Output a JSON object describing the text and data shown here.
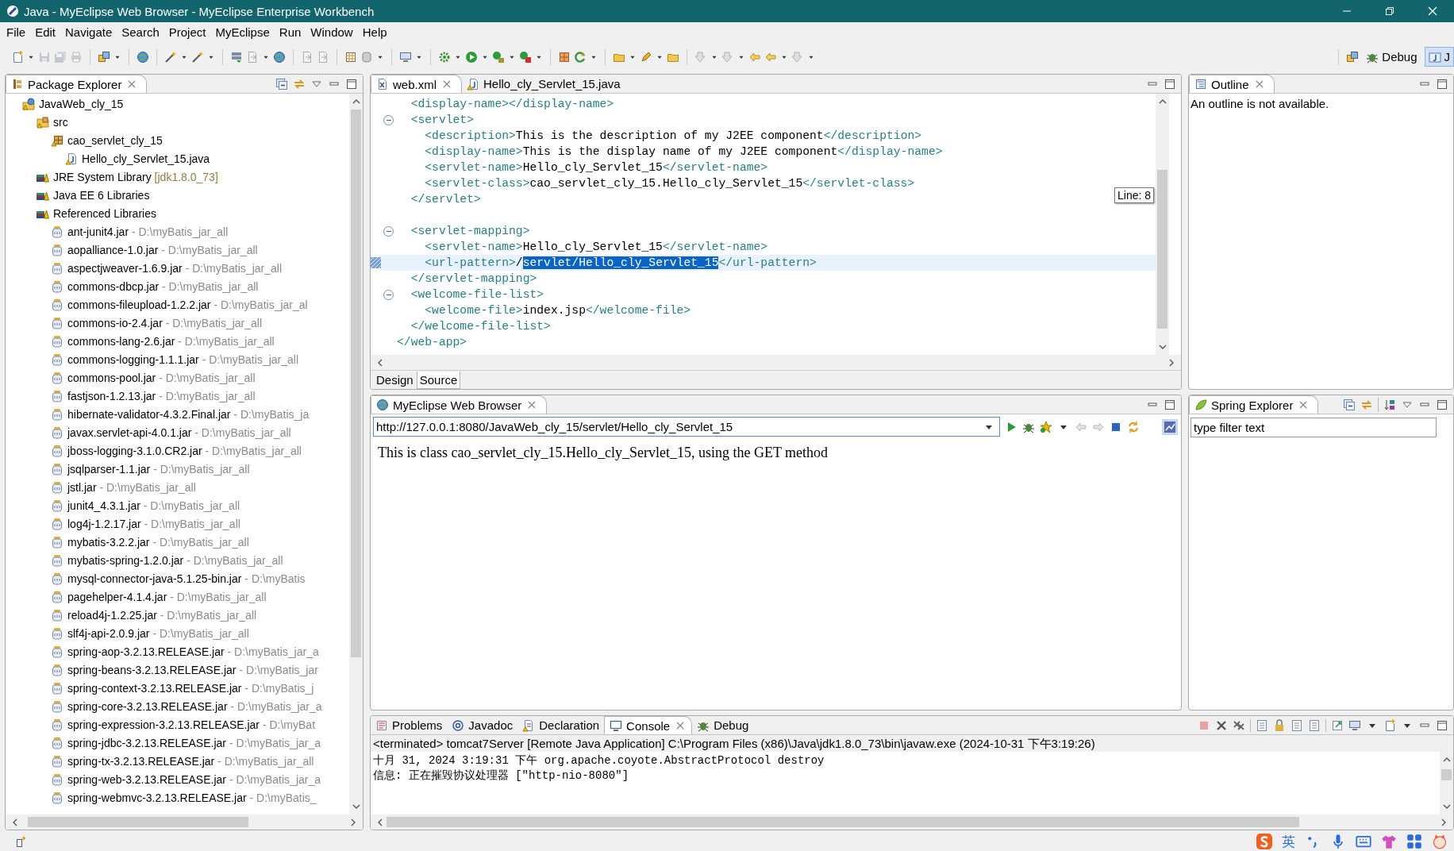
{
  "window": {
    "title": "Java - MyEclipse Web Browser - MyEclipse Enterprise Workbench"
  },
  "menu": [
    "File",
    "Edit",
    "Navigate",
    "Search",
    "Project",
    "MyEclipse",
    "Run",
    "Window",
    "Help"
  ],
  "perspectives": [
    {
      "label": "Debug",
      "kind": "debug",
      "selected": false
    },
    {
      "label": "J",
      "kind": "java",
      "selected": true
    }
  ],
  "package_explorer": {
    "title": "Package Explorer",
    "tree": [
      {
        "label": "JavaWeb_cly_15",
        "kind": "project",
        "children": [
          {
            "label": "src",
            "kind": "source-folder",
            "children": [
              {
                "label": "cao_servlet_cly_15",
                "kind": "package",
                "children": [
                  {
                    "label": "Hello_cly_Servlet_15.java",
                    "kind": "java-file"
                  }
                ]
              }
            ]
          },
          {
            "label": "JRE System Library",
            "detail": "[jdk1.8.0_73]",
            "kind": "library"
          },
          {
            "label": "Java EE 6 Libraries",
            "kind": "library"
          },
          {
            "label": "Referenced Libraries",
            "kind": "library",
            "children": [
              {
                "label": "ant-junit4.jar",
                "detail": "- D:\\myBatis_jar_all",
                "kind": "jar"
              },
              {
                "label": "aopalliance-1.0.jar",
                "detail": "- D:\\myBatis_jar_all",
                "kind": "jar"
              },
              {
                "label": "aspectjweaver-1.6.9.jar",
                "detail": "- D:\\myBatis_jar_all",
                "kind": "jar"
              },
              {
                "label": "commons-dbcp.jar",
                "detail": "- D:\\myBatis_jar_all",
                "kind": "jar"
              },
              {
                "label": "commons-fileupload-1.2.2.jar",
                "detail": "- D:\\myBatis_jar_al",
                "kind": "jar"
              },
              {
                "label": "commons-io-2.4.jar",
                "detail": "- D:\\myBatis_jar_all",
                "kind": "jar"
              },
              {
                "label": "commons-lang-2.6.jar",
                "detail": "- D:\\myBatis_jar_all",
                "kind": "jar"
              },
              {
                "label": "commons-logging-1.1.1.jar",
                "detail": "- D:\\myBatis_jar_all",
                "kind": "jar"
              },
              {
                "label": "commons-pool.jar",
                "detail": "- D:\\myBatis_jar_all",
                "kind": "jar"
              },
              {
                "label": "fastjson-1.2.13.jar",
                "detail": "- D:\\myBatis_jar_all",
                "kind": "jar"
              },
              {
                "label": "hibernate-validator-4.3.2.Final.jar",
                "detail": "- D:\\myBatis_ja",
                "kind": "jar"
              },
              {
                "label": "javax.servlet-api-4.0.1.jar",
                "detail": "- D:\\myBatis_jar_all",
                "kind": "jar"
              },
              {
                "label": "jboss-logging-3.1.0.CR2.jar",
                "detail": "- D:\\myBatis_jar_all",
                "kind": "jar"
              },
              {
                "label": "jsqlparser-1.1.jar",
                "detail": "- D:\\myBatis_jar_all",
                "kind": "jar"
              },
              {
                "label": "jstl.jar",
                "detail": "- D:\\myBatis_jar_all",
                "kind": "jar"
              },
              {
                "label": "junit4_4.3.1.jar",
                "detail": "- D:\\myBatis_jar_all",
                "kind": "jar"
              },
              {
                "label": "log4j-1.2.17.jar",
                "detail": "- D:\\myBatis_jar_all",
                "kind": "jar"
              },
              {
                "label": "mybatis-3.2.2.jar",
                "detail": "- D:\\myBatis_jar_all",
                "kind": "jar"
              },
              {
                "label": "mybatis-spring-1.2.0.jar",
                "detail": "- D:\\myBatis_jar_all",
                "kind": "jar"
              },
              {
                "label": "mysql-connector-java-5.1.25-bin.jar",
                "detail": "- D:\\myBatis",
                "kind": "jar"
              },
              {
                "label": "pagehelper-4.1.4.jar",
                "detail": "- D:\\myBatis_jar_all",
                "kind": "jar"
              },
              {
                "label": "reload4j-1.2.25.jar",
                "detail": "- D:\\myBatis_jar_all",
                "kind": "jar"
              },
              {
                "label": "slf4j-api-2.0.9.jar",
                "detail": "- D:\\myBatis_jar_all",
                "kind": "jar"
              },
              {
                "label": "spring-aop-3.2.13.RELEASE.jar",
                "detail": "- D:\\myBatis_jar_a",
                "kind": "jar"
              },
              {
                "label": "spring-beans-3.2.13.RELEASE.jar",
                "detail": "- D:\\myBatis_jar",
                "kind": "jar"
              },
              {
                "label": "spring-context-3.2.13.RELEASE.jar",
                "detail": "- D:\\myBatis_j",
                "kind": "jar"
              },
              {
                "label": "spring-core-3.2.13.RELEASE.jar",
                "detail": "- D:\\myBatis_jar_a",
                "kind": "jar"
              },
              {
                "label": "spring-expression-3.2.13.RELEASE.jar",
                "detail": "- D:\\myBat",
                "kind": "jar"
              },
              {
                "label": "spring-jdbc-3.2.13.RELEASE.jar",
                "detail": "- D:\\myBatis_jar_a",
                "kind": "jar"
              },
              {
                "label": "spring-tx-3.2.13.RELEASE.jar",
                "detail": "- D:\\myBatis_jar_all",
                "kind": "jar"
              },
              {
                "label": "spring-web-3.2.13.RELEASE.jar",
                "detail": "- D:\\myBatis_jar_a",
                "kind": "jar"
              },
              {
                "label": "spring-webmvc-3.2.13.RELEASE.jar",
                "detail": "- D:\\myBatis_",
                "kind": "jar"
              }
            ]
          }
        ]
      }
    ]
  },
  "editor": {
    "tabs": [
      {
        "label": "web.xml",
        "kind": "xml",
        "selected": true
      },
      {
        "label": "Hello_cly_Servlet_15.java",
        "kind": "java",
        "selected": false
      }
    ],
    "lines": [
      {
        "kind": "code",
        "fold": false,
        "current": false,
        "parts": [
          {
            "kind": "tag",
            "text": "  <display-name></display-name>"
          }
        ]
      },
      {
        "kind": "code",
        "fold": true,
        "current": false,
        "parts": [
          {
            "kind": "tag",
            "text": "  <servlet>"
          }
        ]
      },
      {
        "kind": "code",
        "fold": false,
        "current": false,
        "parts": [
          {
            "kind": "tag",
            "text": "    <description>"
          },
          {
            "kind": "text",
            "text": "This is the description of my J2EE component"
          },
          {
            "kind": "tag",
            "text": "</description>"
          }
        ]
      },
      {
        "kind": "code",
        "fold": false,
        "current": false,
        "parts": [
          {
            "kind": "tag",
            "text": "    <display-name>"
          },
          {
            "kind": "text",
            "text": "This is the display name of my J2EE component"
          },
          {
            "kind": "tag",
            "text": "</display-name>"
          }
        ]
      },
      {
        "kind": "code",
        "fold": false,
        "current": false,
        "parts": [
          {
            "kind": "tag",
            "text": "    <servlet-name>"
          },
          {
            "kind": "text",
            "text": "Hello_cly_Servlet_15"
          },
          {
            "kind": "tag",
            "text": "</servlet-name>"
          }
        ]
      },
      {
        "kind": "code",
        "fold": false,
        "current": false,
        "parts": [
          {
            "kind": "tag",
            "text": "    <servlet-class>"
          },
          {
            "kind": "text",
            "text": "cao_servlet_cly_15.Hello_cly_Servlet_15"
          },
          {
            "kind": "tag",
            "text": "</servlet-class>"
          }
        ]
      },
      {
        "kind": "code",
        "fold": false,
        "current": false,
        "parts": [
          {
            "kind": "tag",
            "text": "  </servlet>"
          }
        ]
      },
      {
        "kind": "blank",
        "fold": false,
        "current": false
      },
      {
        "kind": "code",
        "fold": true,
        "current": false,
        "parts": [
          {
            "kind": "tag",
            "text": "  <servlet-mapping>"
          }
        ]
      },
      {
        "kind": "code",
        "fold": false,
        "current": false,
        "parts": [
          {
            "kind": "tag",
            "text": "    <servlet-name>"
          },
          {
            "kind": "text",
            "text": "Hello_cly_Servlet_15"
          },
          {
            "kind": "tag",
            "text": "</servlet-name>"
          }
        ]
      },
      {
        "kind": "code",
        "fold": false,
        "current": true,
        "parts": [
          {
            "kind": "tag",
            "text": "    <url-pattern>"
          },
          {
            "kind": "text",
            "text": "/"
          },
          {
            "kind": "selected",
            "text": "servlet/Hello_cly_Servlet_15"
          },
          {
            "kind": "tag",
            "text": "</url-pattern>"
          }
        ]
      },
      {
        "kind": "code",
        "fold": false,
        "current": false,
        "parts": [
          {
            "kind": "tag",
            "text": "  </servlet-mapping>"
          }
        ]
      },
      {
        "kind": "code",
        "fold": true,
        "current": false,
        "parts": [
          {
            "kind": "tag",
            "text": "  <welcome-file-list>"
          }
        ]
      },
      {
        "kind": "code",
        "fold": false,
        "current": false,
        "parts": [
          {
            "kind": "tag",
            "text": "    <welcome-file>"
          },
          {
            "kind": "text",
            "text": "index.jsp"
          },
          {
            "kind": "tag",
            "text": "</welcome-file>"
          }
        ]
      },
      {
        "kind": "code",
        "fold": false,
        "current": false,
        "parts": [
          {
            "kind": "tag",
            "text": "  </welcome-file-list>"
          }
        ]
      },
      {
        "kind": "code",
        "fold": false,
        "current": false,
        "parts": [
          {
            "kind": "tag",
            "text": "</web-app>"
          }
        ]
      }
    ],
    "tooltip": "Line: 8",
    "mode_tabs": [
      {
        "label": "Design",
        "selected": false
      },
      {
        "label": "Source",
        "selected": true
      }
    ]
  },
  "outline": {
    "title": "Outline",
    "message": "An outline is not available."
  },
  "browser": {
    "title": "MyEclipse Web Browser",
    "url": "http://127.0.0.1:8080/JavaWeb_cly_15/servlet/Hello_cly_Servlet_15",
    "content": "This is class cao_servlet_cly_15.Hello_cly_Servlet_15, using the GET method"
  },
  "spring_explorer": {
    "title": "Spring Explorer",
    "placeholder": "type filter text"
  },
  "console": {
    "tabs": [
      {
        "label": "Problems",
        "kind": "problems",
        "selected": false
      },
      {
        "label": "Javadoc",
        "kind": "javadoc",
        "selected": false
      },
      {
        "label": "Declaration",
        "kind": "declaration",
        "selected": false
      },
      {
        "label": "Console",
        "kind": "console",
        "selected": true
      },
      {
        "label": "Debug",
        "kind": "debug",
        "selected": false
      }
    ],
    "process": "<terminated> tomcat7Server [Remote Java Application] C:\\Program Files (x86)\\Java\\jdk1.8.0_73\\bin\\javaw.exe (2024-10-31 下午3:19:26)",
    "lines": [
      "十月 31, 2024 3:19:31 下午 org.apache.coyote.AbstractProtocol destroy",
      "信息: 正在摧毁协议处理器 [\"http-nio-8080\"]"
    ]
  },
  "status_bar": {
    "input_language": "英"
  }
}
